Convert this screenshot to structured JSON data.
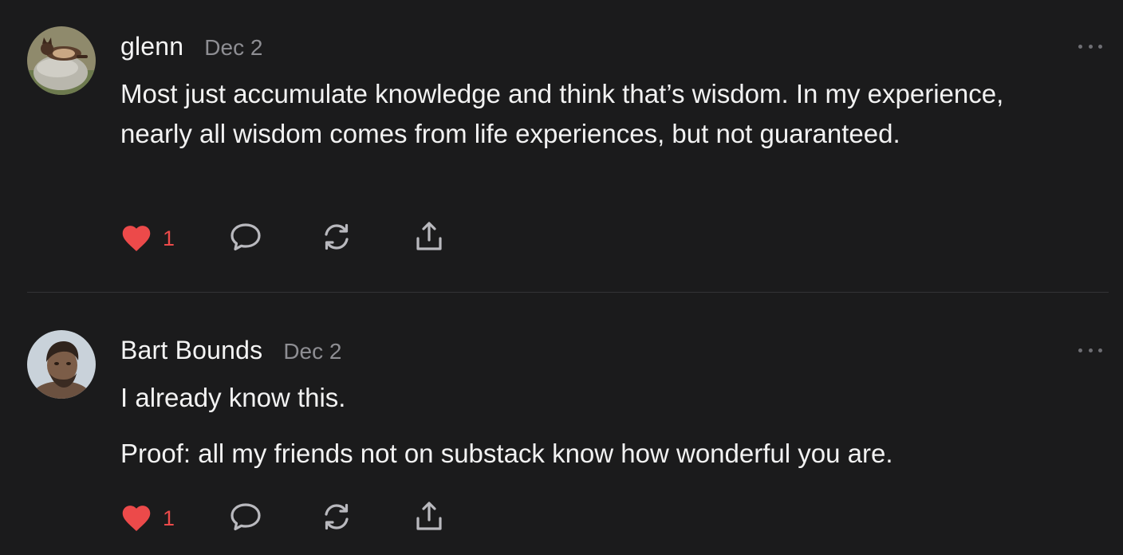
{
  "comments": [
    {
      "author": "glenn",
      "date": "Dec 2",
      "paragraphs": [
        "Most just accumulate knowledge and think that’s wisdom. In my experience, nearly all wisdom comes from life experiences, but not guaranteed."
      ],
      "like_count": "1",
      "avatar": "cat-on-rock"
    },
    {
      "author": "Bart Bounds",
      "date": "Dec 2",
      "paragraphs": [
        "I already know this.",
        "Proof: all my friends not on substack know how wonderful you are."
      ],
      "like_count": "1",
      "avatar": "caveman-figure"
    }
  ],
  "icons": {
    "like": "heart-icon",
    "reply": "speech-bubble-icon",
    "restack": "refresh-icon",
    "share": "share-upload-icon",
    "more": "ellipsis-icon"
  },
  "colors": {
    "background": "#1b1b1c",
    "like_active": "#ec4a4a",
    "text": "#f2f2f2",
    "muted": "#8e8e93"
  }
}
